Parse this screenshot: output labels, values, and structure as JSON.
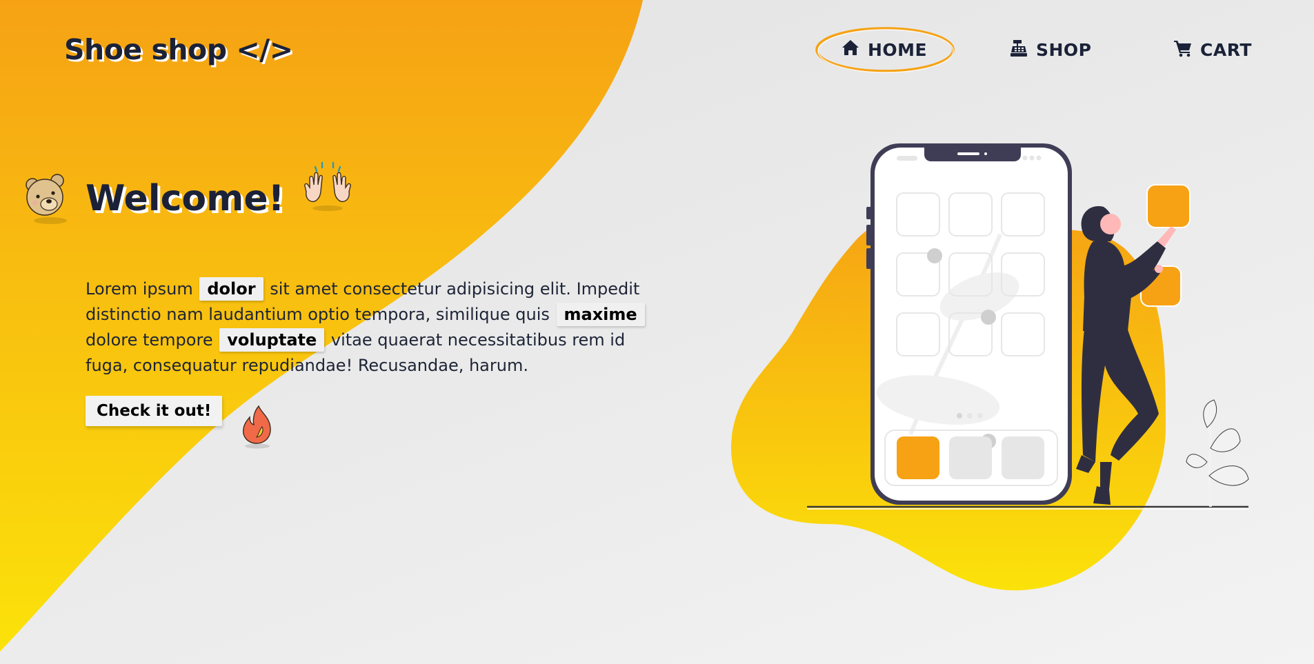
{
  "brand": {
    "name": "Shoe shop",
    "code_symbol": "</>"
  },
  "nav": {
    "items": [
      {
        "label": "HOME",
        "icon": "home-icon",
        "active": true
      },
      {
        "label": "SHOP",
        "icon": "cash-register-icon",
        "active": false
      },
      {
        "label": "CART",
        "icon": "cart-icon",
        "active": false
      }
    ]
  },
  "hero": {
    "title": "Welcome!",
    "text_parts": [
      "Lorem ipsum ",
      "dolor",
      " sit amet consectetur adipisicing elit. Impedit distinctio nam laudantium optio tempora, similique quis ",
      "maxime",
      " dolore tempore ",
      "voluptate",
      " vitae quaerat necessitatibus rem id fuga, consequatur repudiandae! Recusandae, harum."
    ],
    "cta_label": "Check it out!"
  },
  "decorations": {
    "emoji": [
      "bear-icon",
      "raised-hands-icon",
      "fire-icon"
    ]
  },
  "colors": {
    "accent_orange": "#f7a212",
    "accent_yellow": "#fbe20a",
    "dark_navy": "#1b2238",
    "background": "#e6e6e6"
  }
}
